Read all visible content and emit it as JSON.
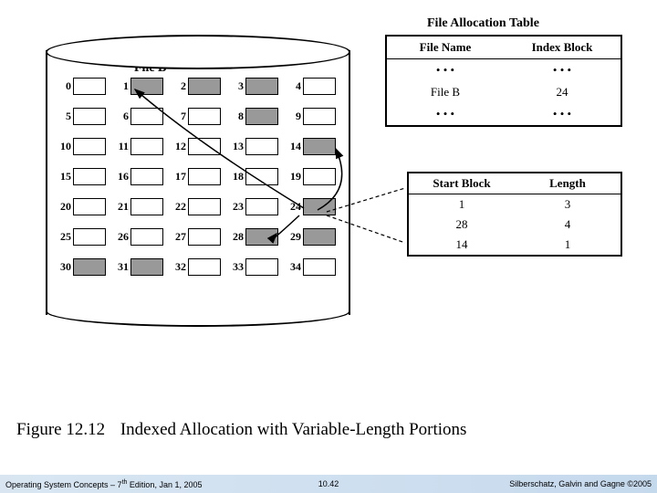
{
  "cylinder": {
    "file_label": "File B",
    "rows": [
      [
        {
          "n": 0,
          "s": false
        },
        {
          "n": 1,
          "s": true
        },
        {
          "n": 2,
          "s": true
        },
        {
          "n": 3,
          "s": true
        },
        {
          "n": 4,
          "s": false
        }
      ],
      [
        {
          "n": 5,
          "s": false
        },
        {
          "n": 6,
          "s": false
        },
        {
          "n": 7,
          "s": false
        },
        {
          "n": 8,
          "s": true
        },
        {
          "n": 9,
          "s": false
        }
      ],
      [
        {
          "n": 10,
          "s": false
        },
        {
          "n": 11,
          "s": false
        },
        {
          "n": 12,
          "s": false
        },
        {
          "n": 13,
          "s": false
        },
        {
          "n": 14,
          "s": true
        }
      ],
      [
        {
          "n": 15,
          "s": false
        },
        {
          "n": 16,
          "s": false
        },
        {
          "n": 17,
          "s": false
        },
        {
          "n": 18,
          "s": false
        },
        {
          "n": 19,
          "s": false
        }
      ],
      [
        {
          "n": 20,
          "s": false
        },
        {
          "n": 21,
          "s": false
        },
        {
          "n": 22,
          "s": false
        },
        {
          "n": 23,
          "s": false
        },
        {
          "n": 24,
          "s": true
        }
      ],
      [
        {
          "n": 25,
          "s": false
        },
        {
          "n": 26,
          "s": false
        },
        {
          "n": 27,
          "s": false
        },
        {
          "n": 28,
          "s": true
        },
        {
          "n": 29,
          "s": true
        }
      ],
      [
        {
          "n": 30,
          "s": true
        },
        {
          "n": 31,
          "s": true
        },
        {
          "n": 32,
          "s": false
        },
        {
          "n": 33,
          "s": false
        },
        {
          "n": 34,
          "s": false
        }
      ]
    ]
  },
  "fat": {
    "title": "File Allocation Table",
    "headers": [
      "File Name",
      "Index Block"
    ],
    "rows": [
      [
        "• • •",
        "• • •"
      ],
      [
        "File B",
        "24"
      ],
      [
        "• • •",
        "• • •"
      ]
    ]
  },
  "index": {
    "headers": [
      "Start Block",
      "Length"
    ],
    "rows": [
      [
        "1",
        "3"
      ],
      [
        "28",
        "4"
      ],
      [
        "14",
        "1"
      ]
    ]
  },
  "caption": {
    "fignum": "Figure 12.12",
    "text": "Indexed Allocation with Variable-Length Portions"
  },
  "footer": {
    "left_prefix": "Operating System Concepts – 7",
    "left_sup": "th",
    "left_suffix": " Edition, Jan 1, 2005",
    "center": "10.42",
    "right": "Silberschatz, Galvin and Gagne ©2005"
  }
}
